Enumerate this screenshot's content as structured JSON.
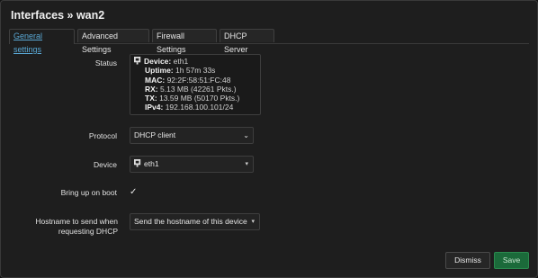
{
  "dialog": {
    "title": "Interfaces » wan2"
  },
  "tabs": [
    {
      "label": "General settings",
      "active": true
    },
    {
      "label": "Advanced Settings",
      "active": false
    },
    {
      "label": "Firewall Settings",
      "active": false
    },
    {
      "label": "DHCP Server",
      "active": false
    }
  ],
  "status": {
    "label": "Status",
    "device_key": "Device:",
    "device_val": "eth1",
    "uptime_key": "Uptime:",
    "uptime_val": "1h 57m 33s",
    "mac_key": "MAC:",
    "mac_val": "92:2F:58:51:FC:48",
    "rx_key": "RX:",
    "rx_val": "5.13 MB (42261 Pkts.)",
    "tx_key": "TX:",
    "tx_val": "13.59 MB (50170 Pkts.)",
    "ipv4_key": "IPv4:",
    "ipv4_val": "192.168.100.101/24"
  },
  "protocol": {
    "label": "Protocol",
    "value": "DHCP client"
  },
  "device": {
    "label": "Device",
    "value": "eth1"
  },
  "bringup": {
    "label": "Bring up on boot",
    "checked": true,
    "mark": "✓"
  },
  "hostname": {
    "label_line1": "Hostname to send when",
    "label_line2": "requesting DHCP",
    "value": "Send the hostname of this device"
  },
  "footer": {
    "dismiss": "Dismiss",
    "save": "Save"
  },
  "colors": {
    "accent_tab": "#5aa9d6",
    "save_bg": "#1b6a3a"
  }
}
